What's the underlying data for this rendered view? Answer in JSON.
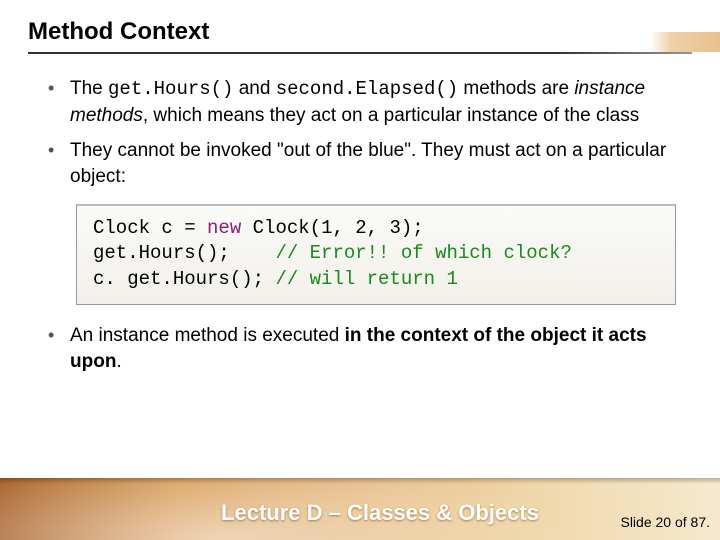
{
  "title": "Method Context",
  "bullets": {
    "b1_pre": "The ",
    "b1_code1": "get.Hours()",
    "b1_mid1": " and ",
    "b1_code2": "second.Elapsed()",
    "b1_mid2": " methods are ",
    "b1_em": "instance methods",
    "b1_post": ", which means they act on a particular instance of the class",
    "b2": "They cannot be invoked \"out of the blue\". They must act on a particular object:",
    "b3_pre": "An instance method is executed ",
    "b3_bold": "in the context of the object it acts upon",
    "b3_post": "."
  },
  "code": {
    "l1a": "Clock c = ",
    "l1kw": "new",
    "l1b": " Clock(1, 2, 3);",
    "l2a": "get.Hours();    ",
    "l2c": "// Error!! of which clock?",
    "l3a": "c. get.Hours(); ",
    "l3c": "// will return 1"
  },
  "footer": {
    "lecture": "Lecture D – Classes & Objects",
    "slide": "Slide 20 of 87."
  }
}
